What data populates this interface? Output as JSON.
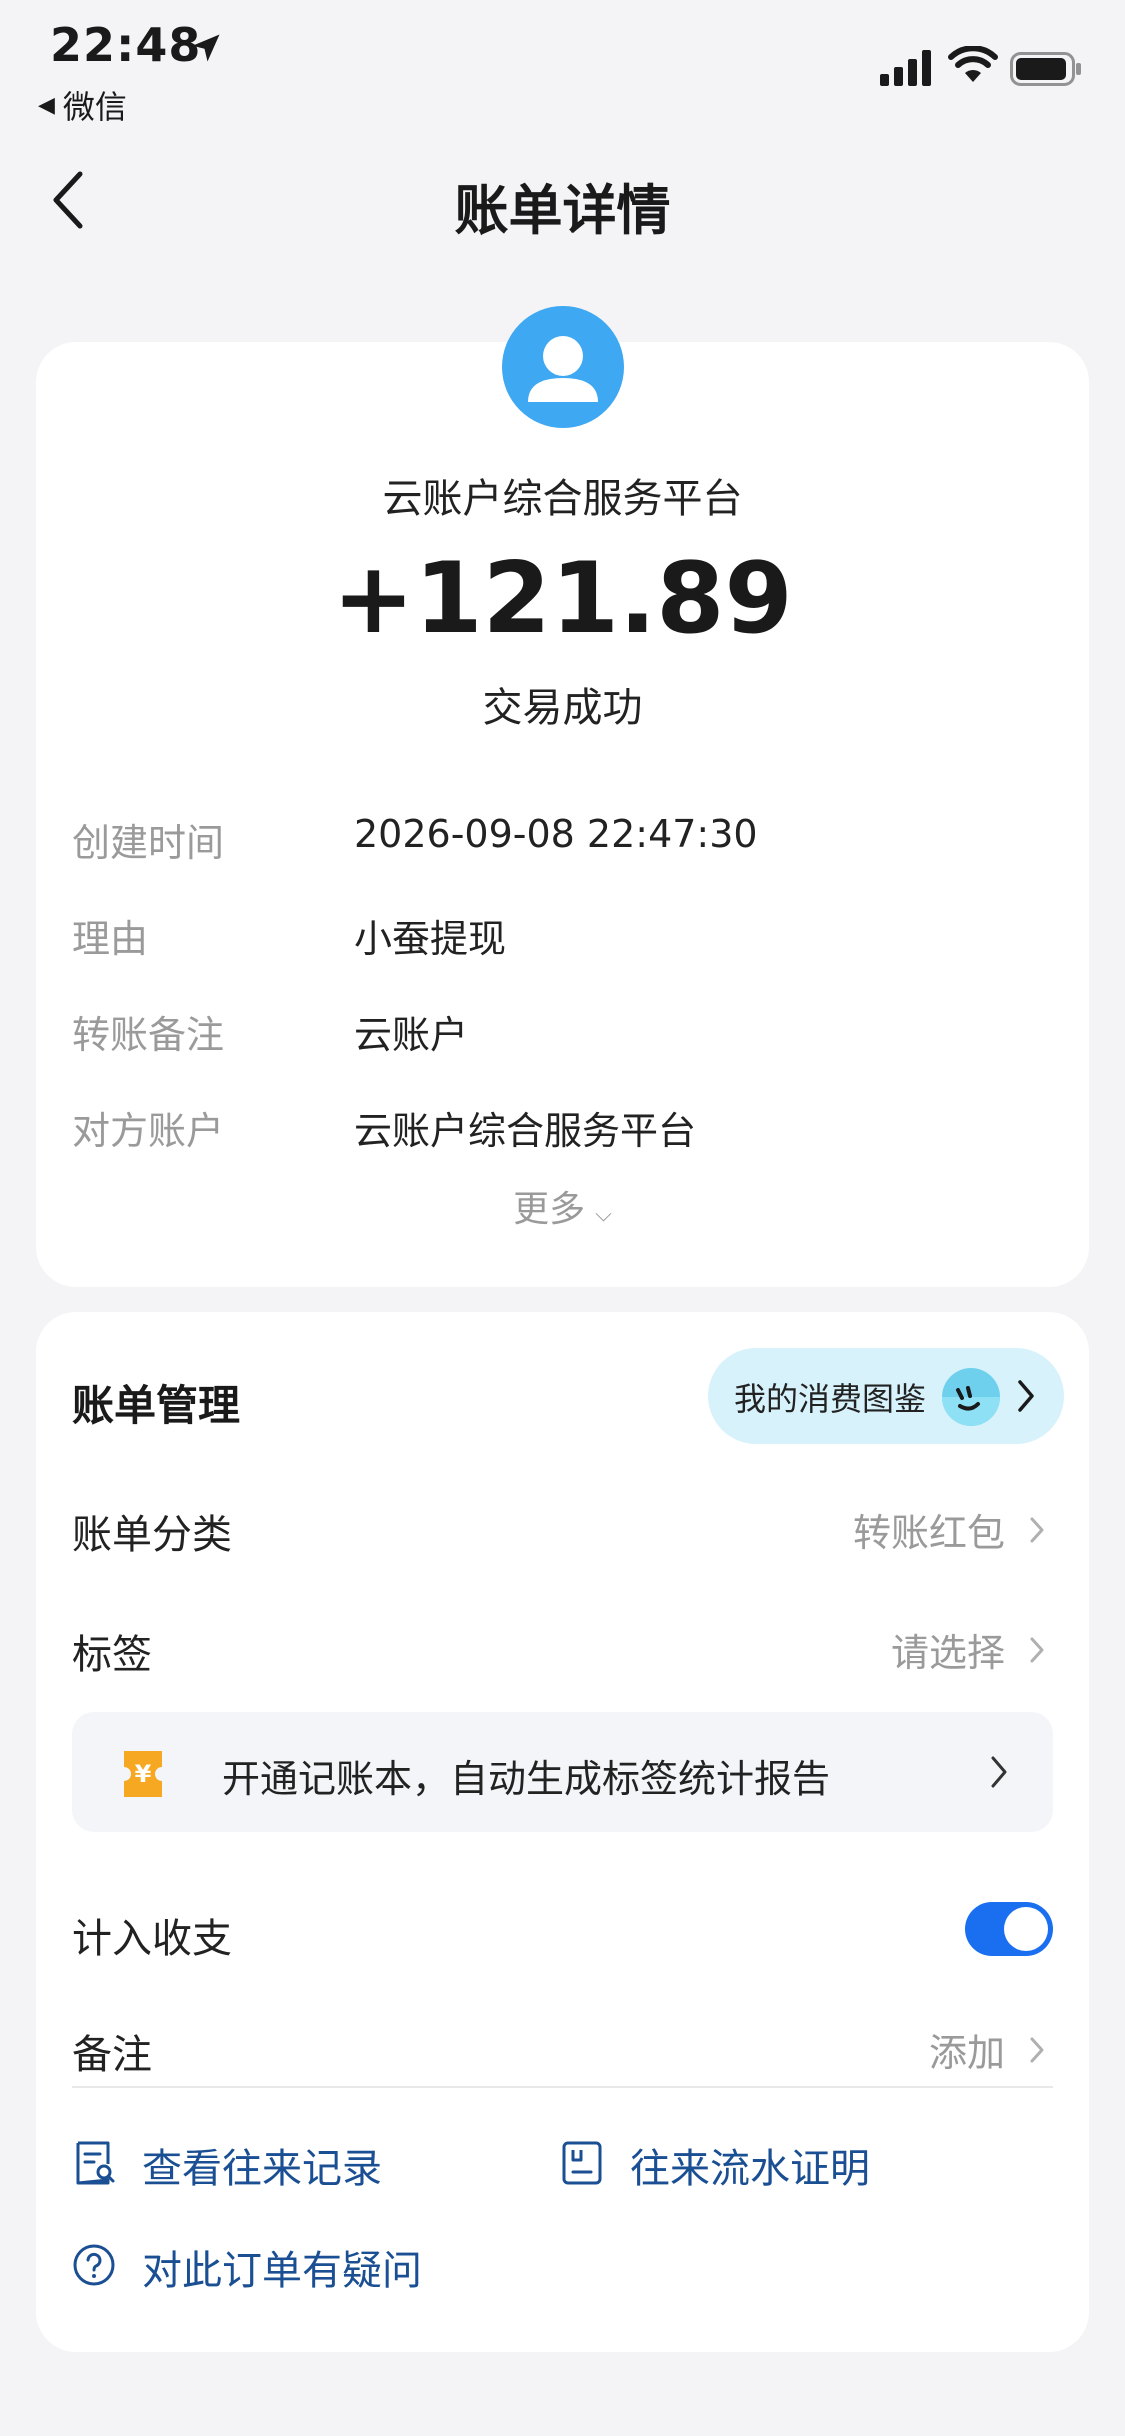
{
  "status_bar": {
    "time": "22:48",
    "back_app_label": "微信"
  },
  "nav": {
    "title": "账单详情"
  },
  "detail": {
    "merchant": "云账户综合服务平台",
    "amount": "+121.89",
    "status": "交易成功",
    "rows": [
      {
        "label": "创建时间",
        "value": "2026-09-08 22:47:30"
      },
      {
        "label": "理由",
        "value": "小蚕提现"
      },
      {
        "label": "转账备注",
        "value": "云账户"
      },
      {
        "label": "对方账户",
        "value": "云账户综合服务平台"
      }
    ],
    "more_label": "更多"
  },
  "manage": {
    "title": "账单管理",
    "guide_label": "我的消费图鉴",
    "category": {
      "label": "账单分类",
      "value": "转账红包"
    },
    "tag": {
      "label": "标签",
      "value": "请选择"
    },
    "promo_text": "开通记账本，自动生成标签统计报告",
    "promo_icon_char": "¥",
    "include": {
      "label": "计入收支",
      "enabled": true
    },
    "note": {
      "label": "备注",
      "value": "添加"
    },
    "links": {
      "history": "查看往来记录",
      "proof": "往来流水证明",
      "question": "对此订单有疑问"
    }
  },
  "colors": {
    "accent": "#1a6ff0",
    "link": "#1b4f93",
    "avatar": "#3ea8f2",
    "promo_icon": "#f7a823"
  }
}
